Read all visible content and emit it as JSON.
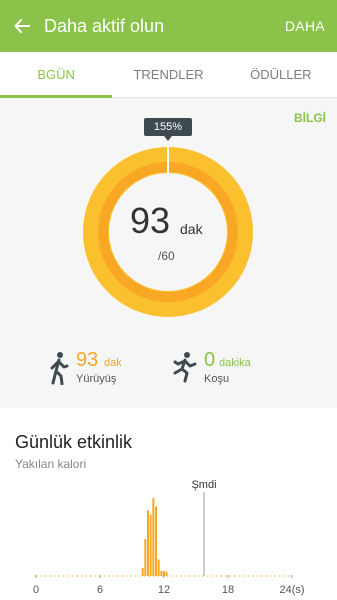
{
  "header": {
    "title": "Daha aktif olun",
    "more_label": "DAHA",
    "color": "#8bc34a"
  },
  "tabs": [
    {
      "label": "BGÜN",
      "active": true
    },
    {
      "label": "TRENDLER",
      "active": false
    },
    {
      "label": "ÖDÜLLER",
      "active": false
    }
  ],
  "summary": {
    "info_label": "BİLGİ",
    "percent": "155%",
    "value": "93",
    "unit": "dak",
    "goal": "/60",
    "progress_percent": 155,
    "ring_color": "#f9a825"
  },
  "stats": {
    "walking": {
      "value": "93",
      "unit": "dak",
      "label": "Yürüyüş",
      "color": "#f9a825"
    },
    "running": {
      "value": "0",
      "unit": "dakika",
      "label": "Koşu",
      "color": "#8bc34a"
    }
  },
  "activity": {
    "title": "Günlük etkinlik",
    "subtitle": "Yakılan kalori",
    "now_label": "Şmdi"
  },
  "chart_data": {
    "type": "bar",
    "x_ticks": [
      "0",
      "6",
      "12",
      "18",
      "24(s)"
    ],
    "xlim": [
      0,
      24
    ],
    "now_hour": 15.75,
    "bar_color": "#f9a825",
    "bars": [
      {
        "x": 10.0,
        "v": 0.1
      },
      {
        "x": 10.25,
        "v": 0.45
      },
      {
        "x": 10.5,
        "v": 0.8
      },
      {
        "x": 10.75,
        "v": 0.75
      },
      {
        "x": 11.0,
        "v": 0.95
      },
      {
        "x": 11.25,
        "v": 0.85
      },
      {
        "x": 11.5,
        "v": 0.2
      },
      {
        "x": 11.75,
        "v": 0.06
      },
      {
        "x": 12.0,
        "v": 0.06
      },
      {
        "x": 12.25,
        "v": 0.05
      }
    ]
  }
}
